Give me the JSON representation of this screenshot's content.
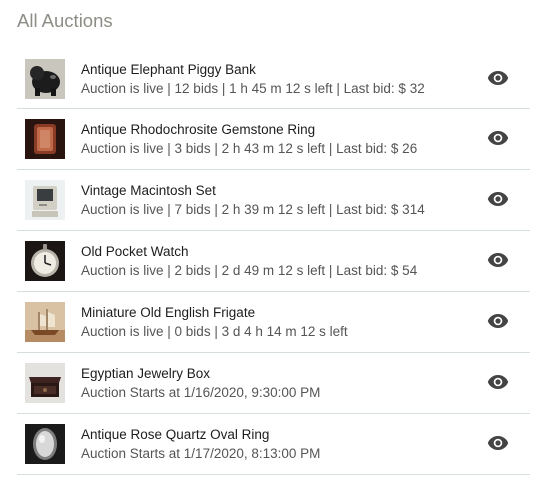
{
  "page": {
    "title": "All Auctions"
  },
  "icons": {
    "thumbnail": "item-thumbnail",
    "view": "eye-icon"
  },
  "colors": {
    "title": "#8d8d86",
    "divider": "#d6dee0",
    "icon": "#444444"
  },
  "auctions": [
    {
      "title": "Antique Elephant Piggy Bank",
      "status": "Auction is live | 12 bids | 1 h 45 m 12 s left | Last bid: $ 32"
    },
    {
      "title": "Antique Rhodochrosite Gemstone Ring",
      "status": "Auction is live | 3 bids | 2 h 43 m 12 s left | Last bid: $ 26"
    },
    {
      "title": "Vintage Macintosh Set",
      "status": "Auction is live | 7 bids | 2 h 39 m 12 s left | Last bid: $ 314"
    },
    {
      "title": "Old Pocket Watch",
      "status": "Auction is live | 2 bids | 2 d 49 m 12 s left | Last bid: $ 54"
    },
    {
      "title": "Miniature Old English Frigate",
      "status": "Auction is live | 0 bids | 3 d 4 h 14 m 12 s left"
    },
    {
      "title": "Egyptian Jewelry Box",
      "status": "Auction Starts at 1/16/2020, 9:30:00 PM"
    },
    {
      "title": "Antique Rose Quartz Oval Ring",
      "status": "Auction Starts at 1/17/2020, 8:13:00 PM"
    }
  ]
}
